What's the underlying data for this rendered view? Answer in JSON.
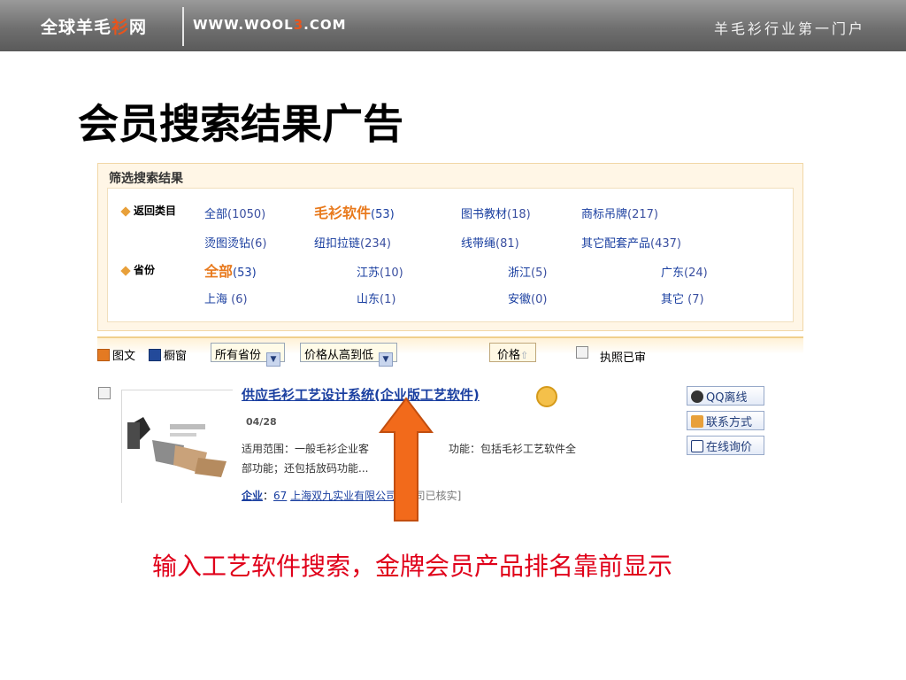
{
  "banner": {
    "logo_a": "全球羊毛",
    "logo_hl": "衫",
    "logo_b": "网",
    "url_a": "WWW.WOOL",
    "url_hl": "3",
    "url_b": ".COM",
    "tagline": "羊毛衫行业第一门户"
  },
  "slide": {
    "title": "会员搜索结果广告",
    "caption": "输入工艺软件搜索，金牌会员产品排名靠前显示"
  },
  "filter": {
    "title": "筛选搜索结果",
    "category_label": "返回类目",
    "province_label": "省份",
    "categories": [
      {
        "name": "全部",
        "count": "(1050)"
      },
      {
        "name": "毛衫软件",
        "count": "(53)"
      },
      {
        "name": "图书教材",
        "count": "(18)"
      },
      {
        "name": "商标吊牌",
        "count": "(217)"
      },
      {
        "name": "烫图烫钻",
        "count": "(6)"
      },
      {
        "name": "纽扣拉链",
        "count": "(234)"
      },
      {
        "name": "线带绳",
        "count": "(81)"
      },
      {
        "name": "其它配套产品",
        "count": "(437)"
      }
    ],
    "provinces": [
      {
        "name": "全部",
        "count": "(53)"
      },
      {
        "name": "江苏",
        "count": "(10)"
      },
      {
        "name": "浙江",
        "count": "(5)"
      },
      {
        "name": "广东",
        "count": "(24)"
      },
      {
        "name": "上海",
        "count": " (6)"
      },
      {
        "name": "山东",
        "count": "(1)"
      },
      {
        "name": "安徽",
        "count": "(0)"
      },
      {
        "name": "其它",
        "count": " (7)"
      }
    ]
  },
  "toolbar": {
    "view_list": "图文",
    "view_grid": "橱窗",
    "province_select": "所有省份",
    "price_select": "价格从高到低",
    "price_sort": "价格",
    "license_label": "执照已审"
  },
  "result": {
    "title": "供应毛衫工艺设计系统(企业版工艺软件)",
    "date": "04/28",
    "scope": "适用范围：一般毛衫企业客",
    "function": "功能：包括毛衫工艺软件全",
    "desc_line2": "部功能；还包括放码功能...",
    "company_label": "企业",
    "company_sep": "：",
    "company_count": "67",
    "company_name": "上海双九实业有限公司",
    "verified": "[公司已核实]",
    "btn_qq": "QQ离线",
    "btn_contact": "联系方式",
    "btn_inquiry": "在线询价"
  }
}
